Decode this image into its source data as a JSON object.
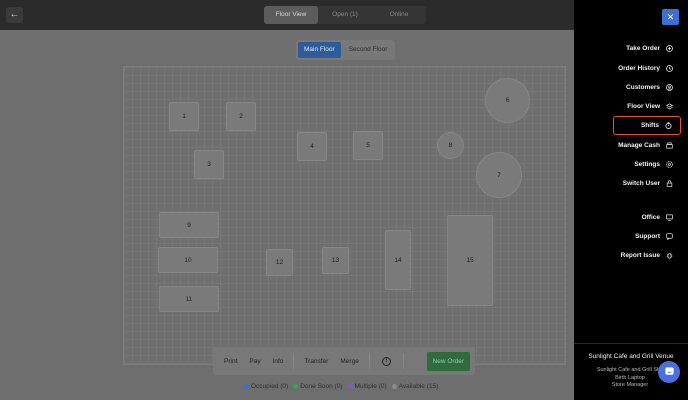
{
  "topbar": {
    "back_icon": "arrow-left-icon",
    "tabs": [
      {
        "label": "Floor View",
        "active": true
      },
      {
        "label": "Open (1)",
        "active": false
      },
      {
        "label": "Online",
        "active": false
      }
    ]
  },
  "floor_tabs": [
    {
      "label": "Main Floor",
      "active": true
    },
    {
      "label": "Second Floor",
      "active": false
    }
  ],
  "tables": [
    {
      "label": "1",
      "shape": "square"
    },
    {
      "label": "2",
      "shape": "square"
    },
    {
      "label": "3",
      "shape": "square"
    },
    {
      "label": "4",
      "shape": "square"
    },
    {
      "label": "5",
      "shape": "square"
    },
    {
      "label": "6",
      "shape": "round"
    },
    {
      "label": "7",
      "shape": "round"
    },
    {
      "label": "8",
      "shape": "round"
    },
    {
      "label": "9",
      "shape": "rect"
    },
    {
      "label": "10",
      "shape": "rect"
    },
    {
      "label": "11",
      "shape": "rect"
    },
    {
      "label": "12",
      "shape": "square"
    },
    {
      "label": "13",
      "shape": "square"
    },
    {
      "label": "14",
      "shape": "rect"
    },
    {
      "label": "15",
      "shape": "rect"
    }
  ],
  "actions": {
    "print": "Print",
    "pay": "Pay",
    "info": "Info",
    "transfer": "Transfer",
    "merge": "Merge",
    "new_order": "New Order"
  },
  "legend": [
    {
      "label": "Occupied (0)",
      "color": "#3b6fd4"
    },
    {
      "label": "Done Soon (0)",
      "color": "#2fa84f"
    },
    {
      "label": "Multiple (0)",
      "color": "#7b5cc4"
    },
    {
      "label": "Available (15)",
      "color": "#8a8a8a"
    }
  ],
  "menu": {
    "close_icon": "close-icon",
    "items": [
      {
        "label": "Take Order",
        "icon": "plus-circle-icon"
      },
      {
        "label": "Order History",
        "icon": "history-icon"
      },
      {
        "label": "Customers",
        "icon": "user-circle-icon"
      },
      {
        "label": "Floor View",
        "icon": "layers-icon"
      },
      {
        "label": "Shifts",
        "icon": "stopwatch-icon",
        "highlight": true
      },
      {
        "label": "Manage Cash",
        "icon": "cash-register-icon"
      },
      {
        "label": "Settings",
        "icon": "gear-icon"
      },
      {
        "label": "Switch User",
        "icon": "lock-icon"
      },
      {
        "label": "Office",
        "icon": "monitor-icon"
      },
      {
        "label": "Support",
        "icon": "chat-icon"
      },
      {
        "label": "Report Issue",
        "icon": "bug-icon"
      }
    ]
  },
  "venue": {
    "name": "Sunlight Cafe and Grill Venue",
    "sub1": "Sunlight Cafe and Grill St...",
    "sub2": "Birth Laptop",
    "sub3": "Store Manager"
  },
  "colors": {
    "accent": "#3b6fd4",
    "highlight_border": "#e8503a",
    "new_order_bg": "#2f6b3c"
  }
}
